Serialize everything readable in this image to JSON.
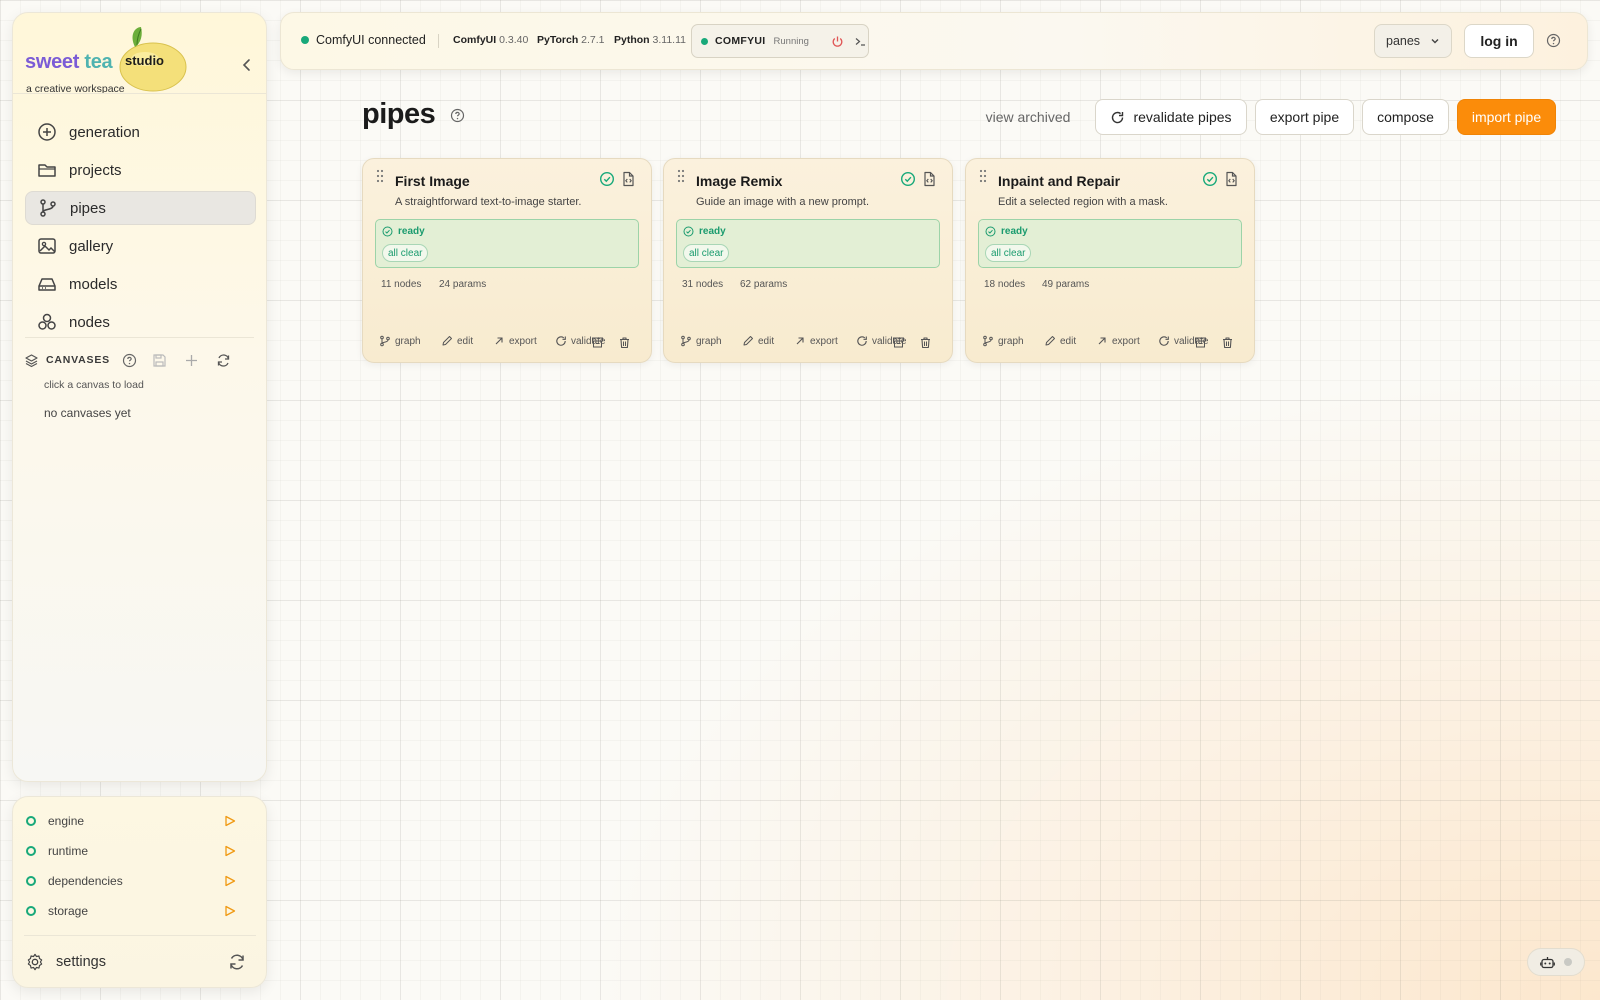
{
  "brand": {
    "name_part1": "sweet",
    "name_part2": "tea",
    "badge": "studio",
    "tagline": "a creative workspace"
  },
  "nav": [
    {
      "label": "generation",
      "icon": "plus-circle-icon"
    },
    {
      "label": "projects",
      "icon": "folder-icon"
    },
    {
      "label": "pipes",
      "icon": "git-branch-icon",
      "active": true
    },
    {
      "label": "gallery",
      "icon": "image-icon"
    },
    {
      "label": "models",
      "icon": "drive-icon"
    },
    {
      "label": "nodes",
      "icon": "boxes-icon"
    }
  ],
  "canvases": {
    "label": "CANVASES",
    "hint": "click a canvas to load",
    "empty": "no canvases yet"
  },
  "status": [
    {
      "label": "engine"
    },
    {
      "label": "runtime"
    },
    {
      "label": "dependencies"
    },
    {
      "label": "storage"
    }
  ],
  "settings": {
    "label": "settings"
  },
  "topbar": {
    "connection": "ComfyUI connected",
    "versions": [
      {
        "name": "ComfyUI",
        "version": "0.3.40"
      },
      {
        "name": "PyTorch",
        "version": "2.7.1"
      },
      {
        "name": "Python",
        "version": "3.11.11"
      }
    ],
    "comfy_label": "COMFYUI",
    "comfy_state": "Running",
    "panes": "panes",
    "login": "log in"
  },
  "page": {
    "title": "pipes",
    "view_archived": "view archived",
    "revalidate": "revalidate pipes",
    "export_pipe": "export pipe",
    "compose": "compose",
    "import_pipe": "import pipe"
  },
  "cards": [
    {
      "title": "First Image",
      "desc": "A straightforward text-to-image starter.",
      "status": "ready",
      "pill": "all clear",
      "nodes": "11 nodes",
      "params": "24 params"
    },
    {
      "title": "Image Remix",
      "desc": "Guide an image with a new prompt.",
      "status": "ready",
      "pill": "all clear",
      "nodes": "31 nodes",
      "params": "62 params"
    },
    {
      "title": "Inpaint and Repair",
      "desc": "Edit a selected region with a mask.",
      "status": "ready",
      "pill": "all clear",
      "nodes": "18 nodes",
      "params": "49 params"
    }
  ],
  "card_actions": {
    "graph": "graph",
    "edit": "edit",
    "export": "export",
    "validate": "validate"
  },
  "colors": {
    "accent": "#fb8c0a",
    "ok_green": "#18a97a",
    "power_red": "#e05656"
  }
}
